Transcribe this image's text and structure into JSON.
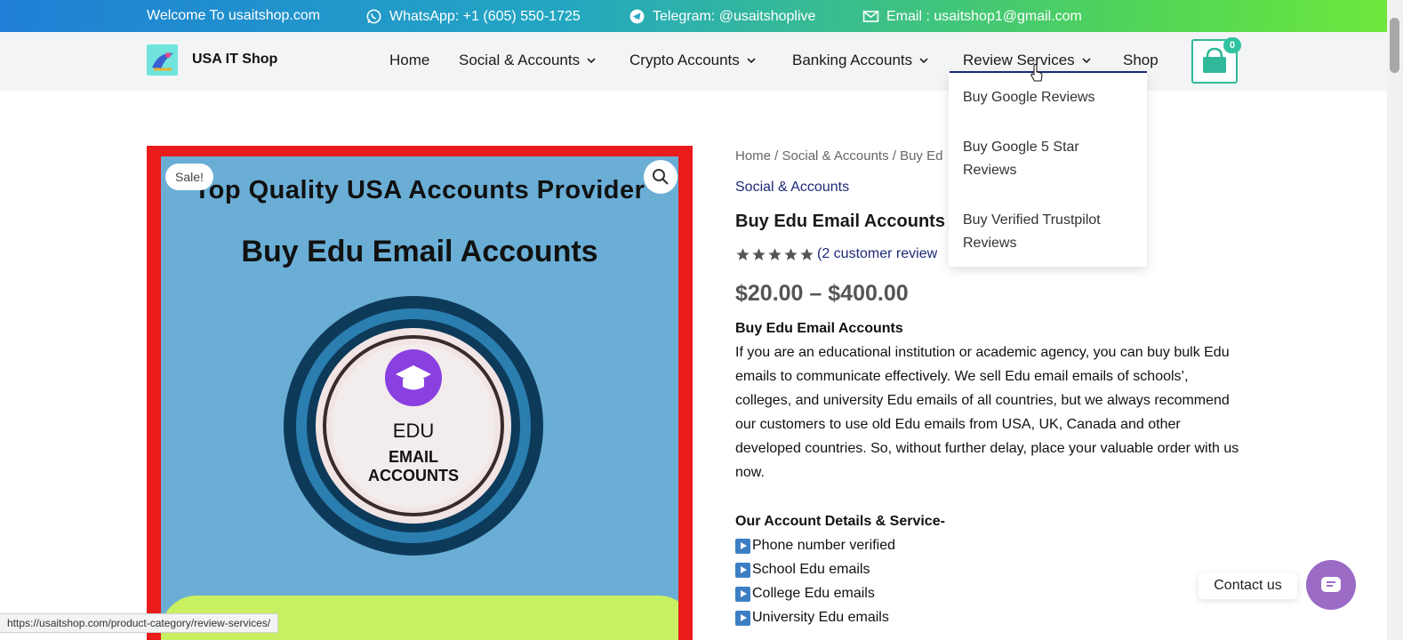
{
  "topbar": {
    "welcome": "Welcome To usaitshop.com",
    "whatsapp": "WhatsApp: +1 (605) 550-1725",
    "telegram": "Telegram: @usaitshoplive",
    "email": "Email : usaitshop1@gmail.com"
  },
  "header": {
    "site_name": "USA IT Shop",
    "nav": [
      "Home",
      "Social & Accounts",
      "Crypto Accounts",
      "Banking Accounts",
      "Review Services",
      "Shop"
    ],
    "cart_count": "0"
  },
  "dropdown": {
    "items": [
      "Buy Google Reviews",
      "Buy Google 5 Star Reviews",
      "Buy Verified Trustpilot Reviews"
    ]
  },
  "product_image": {
    "sale": "Sale!",
    "title1": "Top Quality USA Accounts Provider",
    "title2": "Buy Edu Email Accounts",
    "edu": "EDU",
    "edu_sub1": "EMAIL",
    "edu_sub2": "ACCOUNTS"
  },
  "product": {
    "breadcrumb": "Home / Social & Accounts / Buy Ed",
    "category": "Social & Accounts",
    "title": "Buy Edu Email Accounts",
    "rating": 5,
    "reviews": "(2 customer review",
    "price": "$20.00 – $400.00",
    "desc_head": "Buy Edu Email Accounts",
    "desc": "If you are an educational institution or academic agency, you can buy bulk Edu emails to communicate effectively. We sell Edu email emails of schools’, colleges, and university Edu emails of all countries, but we always recommend our customers to use old Edu emails from USA, UK, Canada and other developed countries. So, without further delay, place your valuable order with us now.",
    "details_head": "Our Account Details & Service-",
    "details": [
      "Phone number verified",
      "School Edu emails",
      "College Edu emails",
      "University Edu emails"
    ]
  },
  "contact": {
    "label": "Contact us"
  },
  "status_url": "https://usaitshop.com/product-category/review-services/",
  "colors": {
    "brand_navy": "#1e2a78",
    "cart_teal": "#2fb89a",
    "contact_purple": "#9b6bc6"
  }
}
